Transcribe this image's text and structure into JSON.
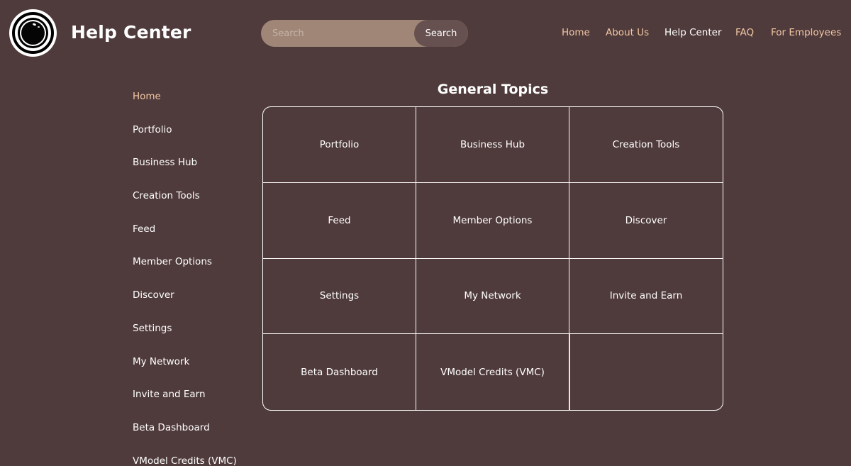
{
  "header": {
    "title": "Help Center",
    "search": {
      "placeholder": "Search",
      "button_label": "Search"
    },
    "nav": [
      {
        "label": "Home",
        "active": false
      },
      {
        "label": "About Us",
        "active": false
      },
      {
        "label": "Help Center",
        "active": true
      },
      {
        "label": "FAQ",
        "active": false
      },
      {
        "label": "For Employees",
        "active": false
      }
    ]
  },
  "sidebar": {
    "items": [
      {
        "label": "Home",
        "active": true
      },
      {
        "label": "Portfolio"
      },
      {
        "label": "Business Hub"
      },
      {
        "label": "Creation Tools"
      },
      {
        "label": "Feed"
      },
      {
        "label": "Member Options"
      },
      {
        "label": "Discover"
      },
      {
        "label": "Settings"
      },
      {
        "label": "My Network"
      },
      {
        "label": "Invite and Earn"
      },
      {
        "label": "Beta Dashboard"
      },
      {
        "label": "VModel Credits (VMC)"
      }
    ]
  },
  "main": {
    "section_title": "General Topics",
    "topics": [
      "Portfolio",
      "Business Hub",
      "Creation Tools",
      "Feed",
      "Member Options",
      "Discover",
      "Settings",
      "My Network",
      "Invite and Earn",
      "Beta Dashboard",
      "VModel Credits (VMC)"
    ]
  },
  "colors": {
    "background": "#503b3c",
    "accent": "#f1c7a3",
    "search_field": "#9f8677",
    "search_button": "#665150"
  }
}
